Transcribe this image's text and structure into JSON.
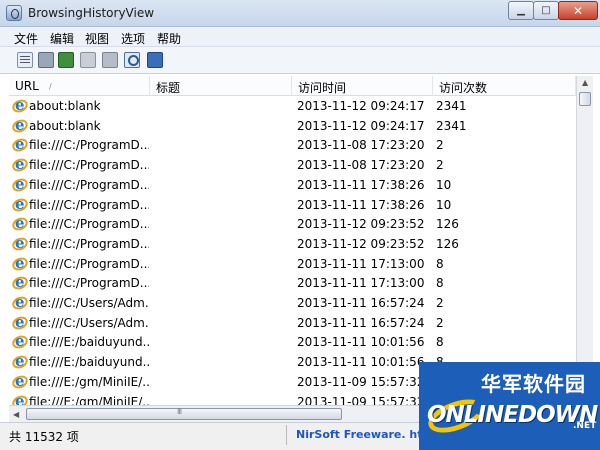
{
  "window": {
    "title": "BrowsingHistoryView"
  },
  "window_controls": {
    "minimize": "▁",
    "maximize": "□",
    "close": "✕"
  },
  "menu": [
    "文件",
    "编辑",
    "视图",
    "选项",
    "帮助"
  ],
  "toolbar_icons": [
    "properties-icon",
    "save-icon",
    "refresh-icon",
    "copy-icon",
    "html-report-icon",
    "find-icon",
    "exit-icon"
  ],
  "columns": {
    "url": "URL",
    "title": "标题",
    "visit_time": "访问时间",
    "visit_count": "访问次数",
    "sort_indicator": "/"
  },
  "rows": [
    {
      "url": "about:blank",
      "title": "",
      "visit_time": "2013-11-12 09:24:17",
      "visit_count": "2341"
    },
    {
      "url": "about:blank",
      "title": "",
      "visit_time": "2013-11-12 09:24:17",
      "visit_count": "2341"
    },
    {
      "url": "file:///C:/ProgramD...",
      "title": "",
      "visit_time": "2013-11-08 17:23:20",
      "visit_count": "2"
    },
    {
      "url": "file:///C:/ProgramD...",
      "title": "",
      "visit_time": "2013-11-08 17:23:20",
      "visit_count": "2"
    },
    {
      "url": "file:///C:/ProgramD...",
      "title": "",
      "visit_time": "2013-11-11 17:38:26",
      "visit_count": "10"
    },
    {
      "url": "file:///C:/ProgramD...",
      "title": "",
      "visit_time": "2013-11-11 17:38:26",
      "visit_count": "10"
    },
    {
      "url": "file:///C:/ProgramD...",
      "title": "",
      "visit_time": "2013-11-12 09:23:52",
      "visit_count": "126"
    },
    {
      "url": "file:///C:/ProgramD...",
      "title": "",
      "visit_time": "2013-11-12 09:23:52",
      "visit_count": "126"
    },
    {
      "url": "file:///C:/ProgramD...",
      "title": "",
      "visit_time": "2013-11-11 17:13:00",
      "visit_count": "8"
    },
    {
      "url": "file:///C:/ProgramD...",
      "title": "",
      "visit_time": "2013-11-11 17:13:00",
      "visit_count": "8"
    },
    {
      "url": "file:///C:/Users/Adm...",
      "title": "",
      "visit_time": "2013-11-11 16:57:24",
      "visit_count": "2"
    },
    {
      "url": "file:///C:/Users/Adm...",
      "title": "",
      "visit_time": "2013-11-11 16:57:24",
      "visit_count": "2"
    },
    {
      "url": "file:///E:/baiduyund...",
      "title": "",
      "visit_time": "2013-11-11 10:01:56",
      "visit_count": "8"
    },
    {
      "url": "file:///E:/baiduyund...",
      "title": "",
      "visit_time": "2013-11-11 10:01:56",
      "visit_count": "8"
    },
    {
      "url": "file:///E:/gm/MiniIE/...",
      "title": "",
      "visit_time": "2013-11-09 15:57:32",
      "visit_count": "3"
    },
    {
      "url": "file:///E:/gm/MiniIE/...",
      "title": "",
      "visit_time": "2013-11-09 15:57:32",
      "visit_count": "3"
    }
  ],
  "status": {
    "count": "共 11532 项",
    "link": "NirSoft Freeware.  http://"
  },
  "watermark": {
    "cn": "华军软件园",
    "en": "ONLINEDOWN",
    "net": ".NET"
  },
  "colors": {
    "titlebar": "#c6d6ea",
    "link": "#1e56c8",
    "watermark_bg": "#1d5fb8",
    "watermark_accent": "#f6c400"
  }
}
